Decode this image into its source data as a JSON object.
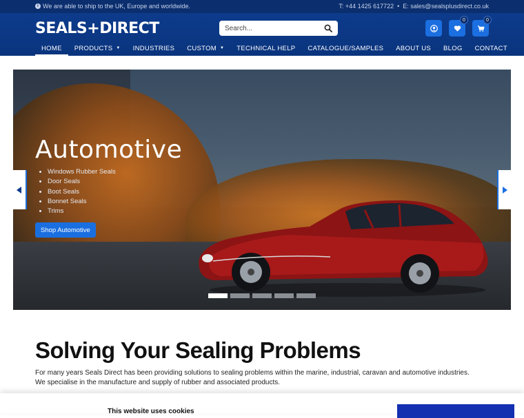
{
  "topbar": {
    "shipping": "We are able to ship to the UK, Europe and worldwide.",
    "phone": "T: +44 1425 617722",
    "separator": "•",
    "email": "E: sales@sealsplusdirect.co.uk"
  },
  "header": {
    "logo": "SEALS+DIRECT",
    "search_placeholder": "Search...",
    "wishlist_count": "0",
    "cart_count": "0"
  },
  "nav": {
    "items": [
      "HOME",
      "PRODUCTS",
      "INDUSTRIES",
      "CUSTOM",
      "TECHNICAL HELP",
      "CATALOGUE/SAMPLES",
      "ABOUT US",
      "BLOG",
      "CONTACT"
    ],
    "active_index": 0
  },
  "hero": {
    "title": "Automotive",
    "list": [
      "Windows Rubber Seals",
      "Door Seals",
      "Boot Seals",
      "Bonnet Seals",
      "Trims"
    ],
    "button": "Shop Automotive",
    "slide_count": 5,
    "active_slide": 0
  },
  "content": {
    "title": "Solving Your Sealing Problems",
    "line1": "For many years Seals Direct has been providing solutions to sealing problems within the marine, industrial, caravan and automotive industries.",
    "line2": "We specialise in the manufacture and supply of rubber and associated products."
  },
  "cookie": {
    "title": "This website uses cookies"
  },
  "colors": {
    "brand_dark": "#0b2e6e",
    "brand": "#0d3b8c",
    "accent": "#1a6fe0"
  }
}
